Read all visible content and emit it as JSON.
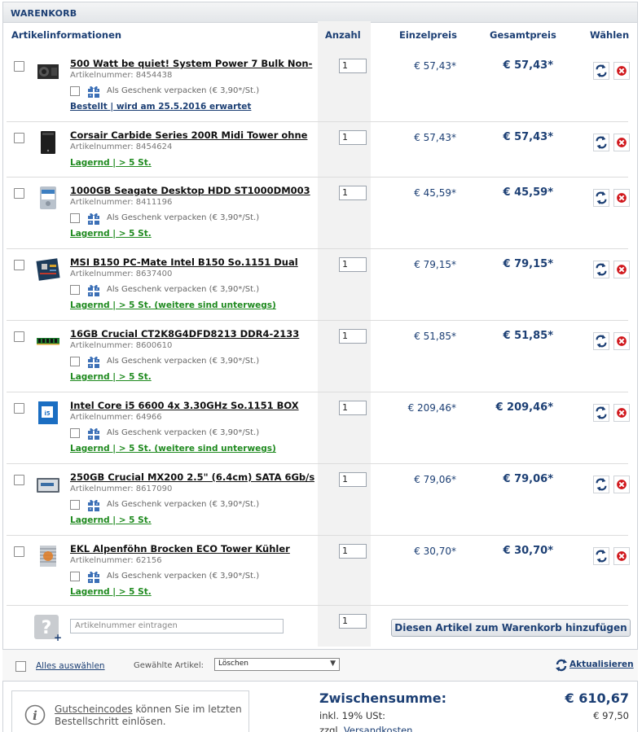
{
  "header": {
    "title": "WARENKORB"
  },
  "columns": {
    "info": "Artikelinformationen",
    "qty": "Anzahl",
    "unit": "Einzelpreis",
    "total": "Gesamtpreis",
    "select": "Wählen"
  },
  "gift_label": "Als Geschenk verpacken (€ 3,90*/St.)",
  "items": [
    {
      "title": "500 Watt be quiet! System Power 7 Bulk Non-",
      "artnr": "Artikelnummer: 8454438",
      "status": "Bestellt | wird am 25.5.2016 erwartet",
      "qty": "1",
      "unit": "€ 57,43*",
      "total": "€ 57,43*"
    },
    {
      "title": "Corsair Carbide Series 200R Midi Tower ohne",
      "artnr": "Artikelnummer: 8454624",
      "status": "Lagernd | > 5 St.",
      "qty": "1",
      "unit": "€ 57,43*",
      "total": "€ 57,43*"
    },
    {
      "title": "1000GB Seagate Desktop HDD ST1000DM003",
      "artnr": "Artikelnummer: 8411196",
      "status": "Lagernd | > 5 St.",
      "qty": "1",
      "unit": "€ 45,59*",
      "total": "€ 45,59*"
    },
    {
      "title": "MSI B150 PC-Mate Intel B150 So.1151 Dual",
      "artnr": "Artikelnummer: 8637400",
      "status": "Lagernd | > 5 St. (weitere sind unterwegs)",
      "qty": "1",
      "unit": "€ 79,15*",
      "total": "€ 79,15*"
    },
    {
      "title": "16GB Crucial CT2K8G4DFD8213 DDR4-2133",
      "artnr": "Artikelnummer: 8600610",
      "status": "Lagernd | > 5 St.",
      "qty": "1",
      "unit": "€ 51,85*",
      "total": "€ 51,85*"
    },
    {
      "title": "Intel Core i5 6600 4x 3.30GHz So.1151 BOX",
      "artnr": "Artikelnummer: 64966",
      "status": "Lagernd | > 5 St. (weitere sind unterwegs)",
      "qty": "1",
      "unit": "€ 209,46*",
      "total": "€ 209,46*"
    },
    {
      "title": "250GB Crucial MX200 2.5\" (6.4cm) SATA 6Gb/s",
      "artnr": "Artikelnummer: 8617090",
      "status": "Lagernd | > 5 St.",
      "qty": "1",
      "unit": "€ 79,06*",
      "total": "€ 79,06*"
    },
    {
      "title": "EKL Alpenföhn Brocken ECO Tower Kühler",
      "artnr": "Artikelnummer: 62156",
      "status": "Lagernd | > 5 St.",
      "qty": "1",
      "unit": "€ 30,70*",
      "total": "€ 30,70*"
    }
  ],
  "add_row": {
    "placeholder": "Artikelnummer eintragen",
    "qty": "1",
    "button": "Diesen Artikel zum Warenkorb hinzufügen"
  },
  "actions": {
    "select_all": "Alles auswählen",
    "selected_label": "Gewählte Artikel:",
    "select_value": "Löschen",
    "refresh": "Aktualisieren"
  },
  "coupon": {
    "link": "Gutscheincodes",
    "text_rest": " können Sie im letzten Bestellschritt einlösen."
  },
  "summary": {
    "subtotal_label": "Zwischensumme:",
    "subtotal_value": "€ 610,67",
    "vat_label": "inkl. 19% USt:",
    "vat_value": "€ 97,50",
    "ship_prefix": "zzgl.",
    "ship_link": "Versandkosten"
  },
  "colors": {
    "accent": "#1c3f74",
    "stock": "#1f8a1f",
    "delete": "#d0161b"
  }
}
